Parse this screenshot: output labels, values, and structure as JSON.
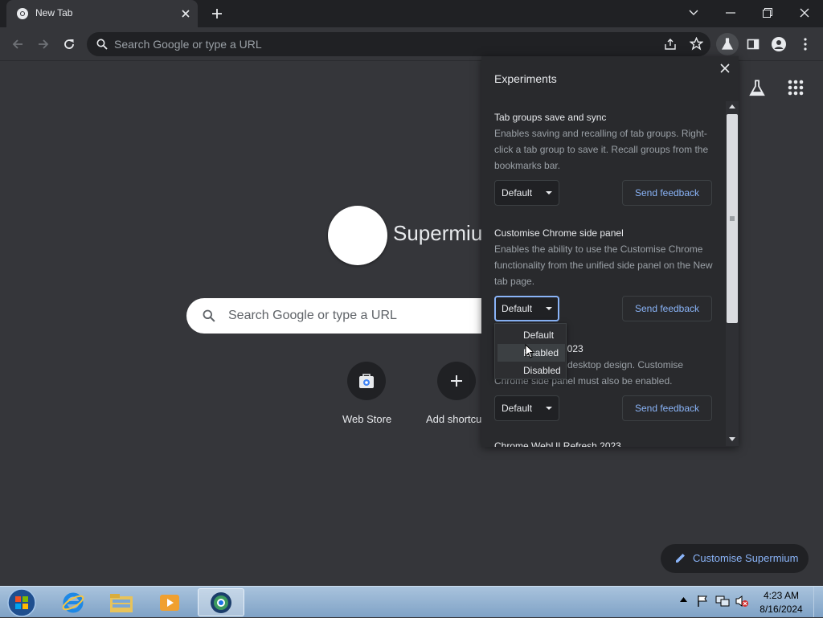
{
  "browser": {
    "tab_title": "New Tab",
    "omnibox_placeholder": "Search Google or type a URL"
  },
  "ntp": {
    "brand": "Supermiu",
    "search_placeholder": "Search Google or type a URL",
    "shortcuts": [
      {
        "label": "Web Store",
        "icon": "web-store-icon"
      },
      {
        "label": "Add shortcu",
        "icon": "plus-icon"
      }
    ],
    "customise_label": "Customise Supermium"
  },
  "experiments": {
    "title": "Experiments",
    "items": [
      {
        "title": "Tab groups save and sync",
        "description": "Enables saving and recalling of tab groups. Right-click a tab group to save it. Recall groups from the bookmarks bar.",
        "select_value": "Default",
        "feedback_label": "Send feedback"
      },
      {
        "title": "Customise Chrome side panel",
        "description": "Enables the ability to use the Customise Chrome functionality from the unified side panel on the New tab page.",
        "select_value": "Default",
        "feedback_label": "Send feedback"
      },
      {
        "title_fragment": "2023",
        "description_fragment_1": "desktop design. Customise",
        "description_fragment_2": "Chrome side panel must also be enabled.",
        "select_value": "Default",
        "feedback_label": "Send feedback"
      },
      {
        "title_partial": "Chrome WebUI Refresh 2023"
      }
    ],
    "dropdown_options": [
      "Default",
      "Enabled",
      "Disabled"
    ],
    "dropdown_highlighted": "Enabled"
  },
  "taskbar": {
    "clock_time": "4:23 AM",
    "clock_date": "8/16/2024"
  },
  "colors": {
    "accent": "#8ab4f8",
    "page_bg": "#35363a",
    "panel_bg": "#292a2d"
  }
}
